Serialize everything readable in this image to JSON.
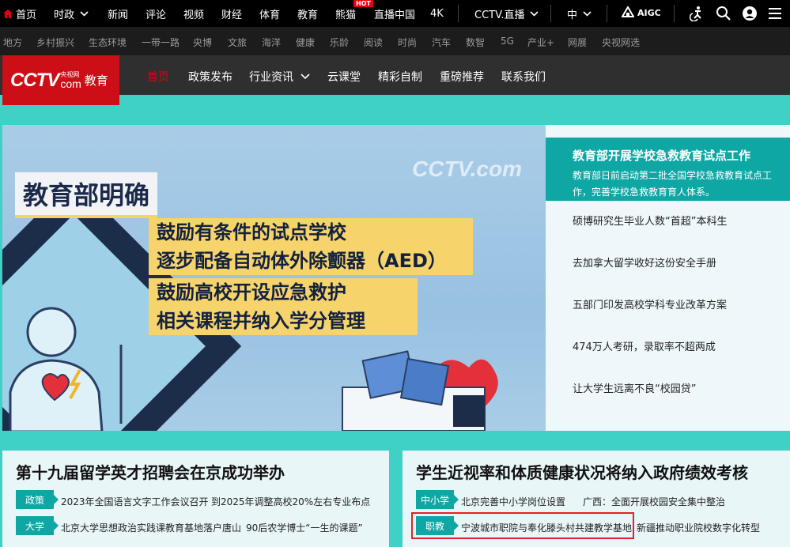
{
  "topnav": {
    "items": [
      "首页",
      "时政",
      "新闻",
      "评论",
      "视频",
      "财经",
      "体育",
      "教育",
      "熊猫",
      "直播中国",
      "4K",
      "CCTV.直播",
      "中"
    ],
    "hot_badge": "HOT",
    "aigc": "AIGC"
  },
  "subnav": [
    "地方",
    "乡村振兴",
    "生态环境",
    "一带一路",
    "央博",
    "文旅",
    "海洋",
    "健康",
    "乐龄",
    "阅读",
    "时尚",
    "汽车",
    "数智",
    "5G",
    "产业+",
    "网展",
    "央视网选"
  ],
  "channel": {
    "logo_cctv": "CCTV",
    "logo_site_cn": "央视网",
    "logo_site_en": "com",
    "logo_channel": "教育",
    "nav": [
      "首页",
      "政策发布",
      "行业资讯",
      "云课堂",
      "精彩自制",
      "重磅推荐",
      "联系我们"
    ]
  },
  "hero": {
    "title": "教育部明确",
    "box1_line1": "鼓励有条件的试点学校",
    "box1_line2": "逐步配备自动体外除颤器（AED）",
    "box2_line1": "鼓励高校开设应急救护",
    "box2_line2": "相关课程并纳入学分管理",
    "watermark": "CCTV.com"
  },
  "side": {
    "active_title": "教育部开展学校急救教育试点工作",
    "active_desc": "教育部日前启动第二批全国学校急救教育试点工作，完善学校急救教育育人体系。",
    "items": [
      "硕博研究生毕业人数“首超”本科生",
      "去加拿大留学收好这份安全手册",
      "五部门印发高校学科专业改革方案",
      "474万人考研，录取率不超两成",
      "让大学生远离不良“校园贷”"
    ]
  },
  "card_left": {
    "title": "第十九届留学英才招聘会在京成功举办",
    "rows": [
      {
        "tag": "政策",
        "a": "2023年全国语言文字工作会议召开",
        "b": "到2025年调整高校20%左右专业布点"
      },
      {
        "tag": "大学",
        "a": "北京大学思想政治实践课教育基地落户唐山",
        "b": "90后农学博士“一生的课题”"
      }
    ]
  },
  "card_right": {
    "title": "学生近视率和体质健康状况将纳入政府绩效考核",
    "rows": [
      {
        "tag": "中小学",
        "a": "北京完善中小学岗位设置",
        "b": "广西：全面开展校园安全集中整治"
      },
      {
        "tag": "职教",
        "a": "宁波城市职院与奉化滕头村共建教学基地",
        "b": "新疆推动职业院校数字化转型"
      }
    ]
  }
}
